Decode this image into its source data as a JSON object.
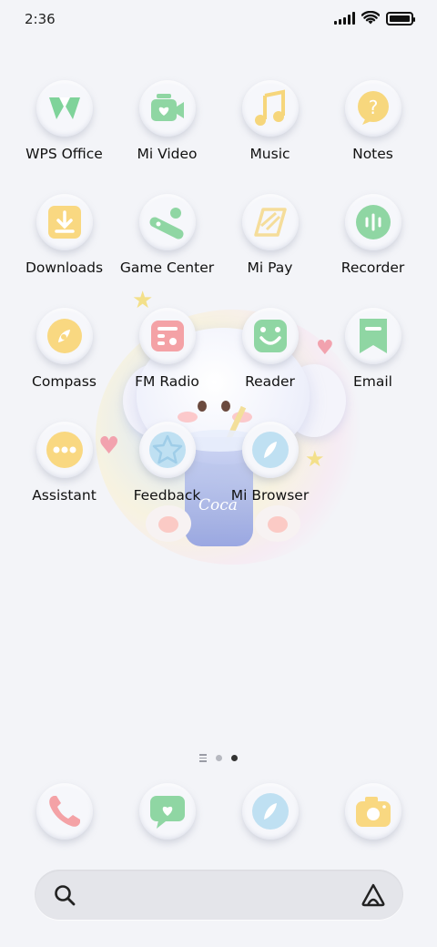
{
  "status_bar": {
    "time": "2:36",
    "signal_icon": "signal-bars-icon",
    "wifi_icon": "wifi-icon",
    "battery_icon": "battery-icon",
    "battery_level": 1.0
  },
  "apps": [
    {
      "label": "WPS Office",
      "icon": "wps-office-icon",
      "color": "#7fd39a"
    },
    {
      "label": "Mi Video",
      "icon": "video-camera-icon",
      "color": "#8fd6a3"
    },
    {
      "label": "Music",
      "icon": "music-note-icon",
      "color": "#f6d67b"
    },
    {
      "label": "Notes",
      "icon": "notes-icon",
      "color": "#f7d77d"
    },
    {
      "label": "Downloads",
      "icon": "download-icon",
      "color": "#f9d881"
    },
    {
      "label": "Game Center",
      "icon": "game-controller-icon",
      "color": "#8fd6a3"
    },
    {
      "label": "Mi Pay",
      "icon": "card-icon",
      "color": "#f5dd9a"
    },
    {
      "label": "Recorder",
      "icon": "recorder-icon",
      "color": "#8fd6a3"
    },
    {
      "label": "Compass",
      "icon": "compass-icon",
      "color": "#f9d881"
    },
    {
      "label": "FM Radio",
      "icon": "radio-icon",
      "color": "#f4a2a6"
    },
    {
      "label": "Reader",
      "icon": "reader-smile-icon",
      "color": "#8fd6a3"
    },
    {
      "label": "Email",
      "icon": "email-bookmark-icon",
      "color": "#8fd6a3"
    },
    {
      "label": "Assistant",
      "icon": "assistant-dots-icon",
      "color": "#f9d881"
    },
    {
      "label": "Feedback",
      "icon": "star-icon",
      "color": "#bfe0f2"
    },
    {
      "label": "Mi Browser",
      "icon": "browser-compass-icon",
      "color": "#bfe0f2"
    }
  ],
  "dock": [
    {
      "icon": "phone-icon",
      "color": "#f4a2a6"
    },
    {
      "icon": "message-heart-icon",
      "color": "#8fd6a3"
    },
    {
      "icon": "browser-compass-icon",
      "color": "#bfe0f2"
    },
    {
      "icon": "camera-icon",
      "color": "#f9d881"
    }
  ],
  "page_indicator": {
    "pages": 2,
    "current": 2
  },
  "wallpaper": {
    "cup_text": "Coca"
  },
  "search": {
    "icon": "search-icon",
    "assistant_icon": "assistant-triangle-icon"
  }
}
